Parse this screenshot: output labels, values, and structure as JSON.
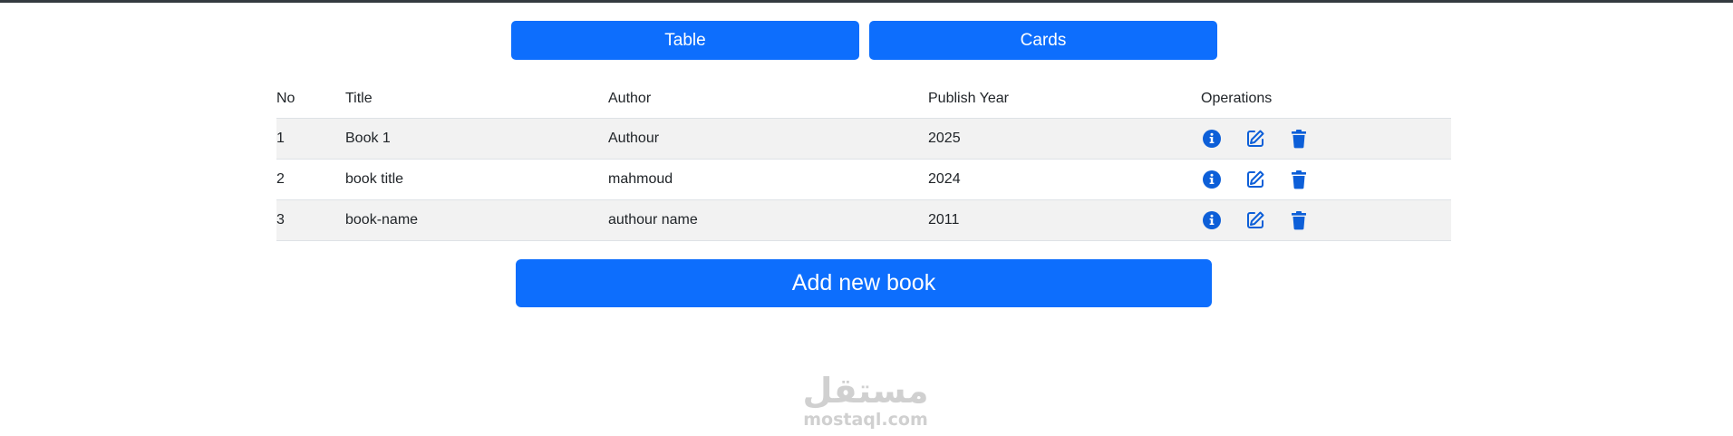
{
  "view_toggle": {
    "table_label": "Table",
    "cards_label": "Cards"
  },
  "table": {
    "headers": {
      "no": "No",
      "title": "Title",
      "author": "Author",
      "year": "Publish Year",
      "operations": "Operations"
    },
    "rows": [
      {
        "no": "1",
        "title": "Book 1",
        "author": "Authour",
        "year": "2025"
      },
      {
        "no": "2",
        "title": "book title",
        "author": "mahmoud",
        "year": "2024"
      },
      {
        "no": "3",
        "title": "book-name",
        "author": "authour name",
        "year": "2011"
      }
    ],
    "operation_icons": [
      "info-circle-icon",
      "edit-icon",
      "trash-icon"
    ]
  },
  "add_button": {
    "label": "Add new book"
  },
  "watermark": {
    "arabic": "مستقل",
    "latin": "mostaql.com"
  },
  "colors": {
    "primary": "#0d6efd",
    "icon": "#0d5fd8",
    "stripe": "#f2f2f2",
    "topbar": "#343a40"
  }
}
